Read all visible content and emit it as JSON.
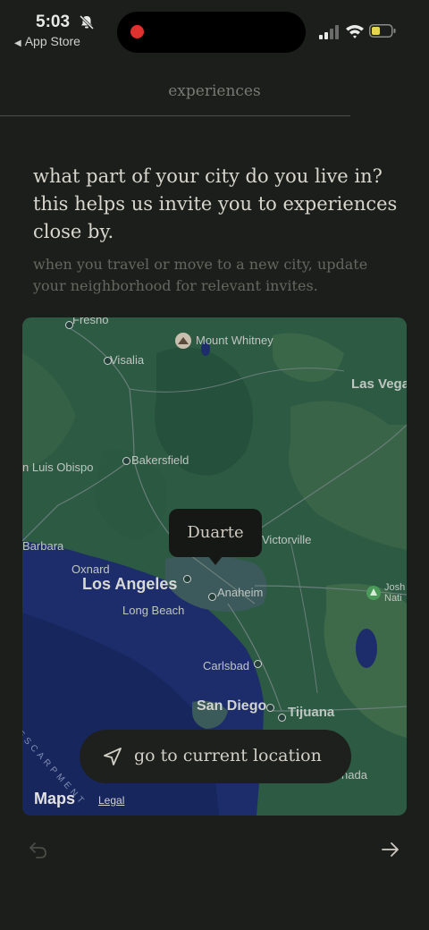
{
  "status_bar": {
    "time": "5:03",
    "back_app": "App Store"
  },
  "nav": {
    "title": "experiences"
  },
  "prompt": {
    "heading": "what part of your city do you live in? this helps us invite you to experiences close by.",
    "subtext": "when you travel or move to a new city, update your neighborhood for relevant invites."
  },
  "map": {
    "selected_neighborhood": "Duarte",
    "labels": {
      "fresno": "Fresno",
      "mount_whitney": "Mount Whitney",
      "visalia": "Visalia",
      "las_vegas": "Las Vega",
      "san_luis_obispo": "n Luis Obispo",
      "bakersfield": "Bakersfield",
      "santa_barbara": "Barbara",
      "victorville": "Victorville",
      "oxnard": "Oxnard",
      "los_angeles": "Los Angeles",
      "anaheim": "Anaheim",
      "joshua_tree": "Josh\nNati",
      "long_beach": "Long Beach",
      "carlsbad": "Carlsbad",
      "san_diego": "San Diego",
      "tijuana": "Tijuana",
      "escarpment": "ESCARPMENT",
      "mexicali": "nada"
    },
    "current_location_label": "go to current location",
    "attribution": "Maps",
    "legal": "Legal"
  },
  "colors": {
    "background": "#1b1e1a",
    "land": "#2c5a43",
    "ocean": "#1d2d6b",
    "recording_dot": "#e0312f",
    "battery": "#e6d74a"
  }
}
